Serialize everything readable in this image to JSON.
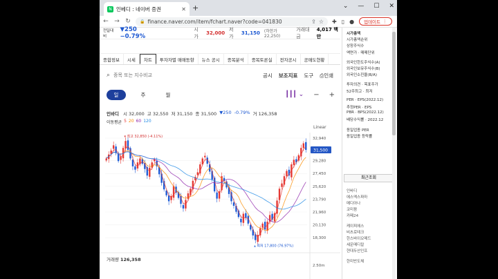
{
  "browser": {
    "tab_title": "인베디 : 네이버 증권",
    "tab_fav": "N",
    "url": "finance.naver.com/item/fchart.naver?code=041830",
    "update_label": "업데이트"
  },
  "stock": {
    "abbr": "전일대비",
    "change": "▼250",
    "change_pct": "−0.79%",
    "open_label": "시가",
    "open": "32,000",
    "low_label": "저가",
    "low": "31,150",
    "low_limit": "(하한가 22,250)",
    "volume_label": "거래대금",
    "volume": "4,017 백만"
  },
  "nav_tabs": [
    "종합정보",
    "시세",
    "차트",
    "투자자별 매매동향",
    "뉴스 공시",
    "종목분석",
    "종목토론실",
    "전자공시",
    "공매도현황"
  ],
  "toolbar": {
    "search_placeholder": "종목 또는 지수비교",
    "items": [
      "공시",
      "보조지표",
      "도구",
      "인쇄"
    ]
  },
  "periods": [
    "일",
    "주",
    "월"
  ],
  "ohlc": {
    "name": "인바디",
    "o_label": "시",
    "o": "32,000",
    "h_label": "고",
    "h": "32,550",
    "l_label": "저",
    "l": "31,150",
    "c_label": "종",
    "c": "31,500",
    "chg": "▼250",
    "pct": "-0.79%",
    "v_label": "거",
    "v": "126,358"
  },
  "ma_legend": {
    "label": "이동평균",
    "items": [
      {
        "text": "5",
        "color": "#e53935"
      },
      {
        "text": "20",
        "color": "#fb8c00"
      },
      {
        "text": "60",
        "color": "#8e24aa"
      },
      {
        "text": "120",
        "color": "#1e88e5"
      }
    ]
  },
  "scale_mode": "Linear",
  "chart_data": {
    "type": "line",
    "title": "",
    "y_ticks": [
      "32,940",
      "29,280",
      "27,450",
      "25,620",
      "23,790",
      "21,960",
      "20,130",
      "18,300"
    ],
    "current_price_label": "31,500",
    "max_annotation": "최고 32,850 (-4.11%)",
    "min_annotation": "최저 17,800 (76.97%)",
    "volume_label": "거래량",
    "volume_value": "126,358",
    "volume_tick": "2.50m",
    "ylim": [
      16500,
      33500
    ],
    "close_series": [
      30200,
      30800,
      31400,
      32200,
      31000,
      29800,
      30500,
      31800,
      32850,
      31500,
      30200,
      29000,
      28500,
      29600,
      30200,
      29400,
      28600,
      27600,
      28800,
      29600,
      30100,
      29000,
      27800,
      26500,
      25500,
      24600,
      23700,
      24500,
      26000,
      25000,
      24200,
      23300,
      22600,
      23900,
      24900,
      25600,
      26800,
      27400,
      28100,
      29300,
      30200,
      30600,
      29400,
      28200,
      27000,
      25200,
      24100,
      25200,
      27500,
      26800,
      25800,
      24800,
      23700,
      23000,
      22100,
      21300,
      20500,
      21800,
      21200,
      20300,
      19400,
      18500,
      17800,
      18600,
      19600,
      20300,
      19400,
      20600,
      21600,
      20900,
      21900,
      23800,
      25600,
      26400,
      27500,
      28300,
      27600,
      29300,
      30000,
      29600,
      30700,
      31800,
      32500,
      31500
    ],
    "ma_series": [
      {
        "name": "5",
        "color": "#e53935"
      },
      {
        "name": "20",
        "color": "#fb8c00"
      },
      {
        "name": "60",
        "color": "#8e24aa"
      },
      {
        "name": "120",
        "color": "#1e88e5"
      }
    ]
  },
  "right_panel": {
    "items": [
      "시가총액",
      "시가총액순위",
      "상장주식수",
      "액면가 · 매매단위",
      "",
      "외국인한도주식수(A)",
      "외국인보유주식수(B)",
      "외국인소진율(B/A)",
      "",
      "투자의견 · 목표주가",
      "52주최고 · 최저",
      "",
      "PER · EPS(2022.12)",
      "추정PER · EPS",
      "PBR · BPS(2022.12)",
      "배당수익률 · 2022.12",
      "",
      "동일업종 PER",
      "동일업종 등락률"
    ],
    "recent_title": "최근조회",
    "recent": [
      "인바디",
      "에스엑스파마",
      "메디아나",
      "코미팜",
      "카페24",
      "",
      "케이피에스",
      "비츠로테크",
      "한스바이오메드",
      "세운메디칼",
      "현대두산인프",
      "",
      "한미반도체"
    ]
  }
}
